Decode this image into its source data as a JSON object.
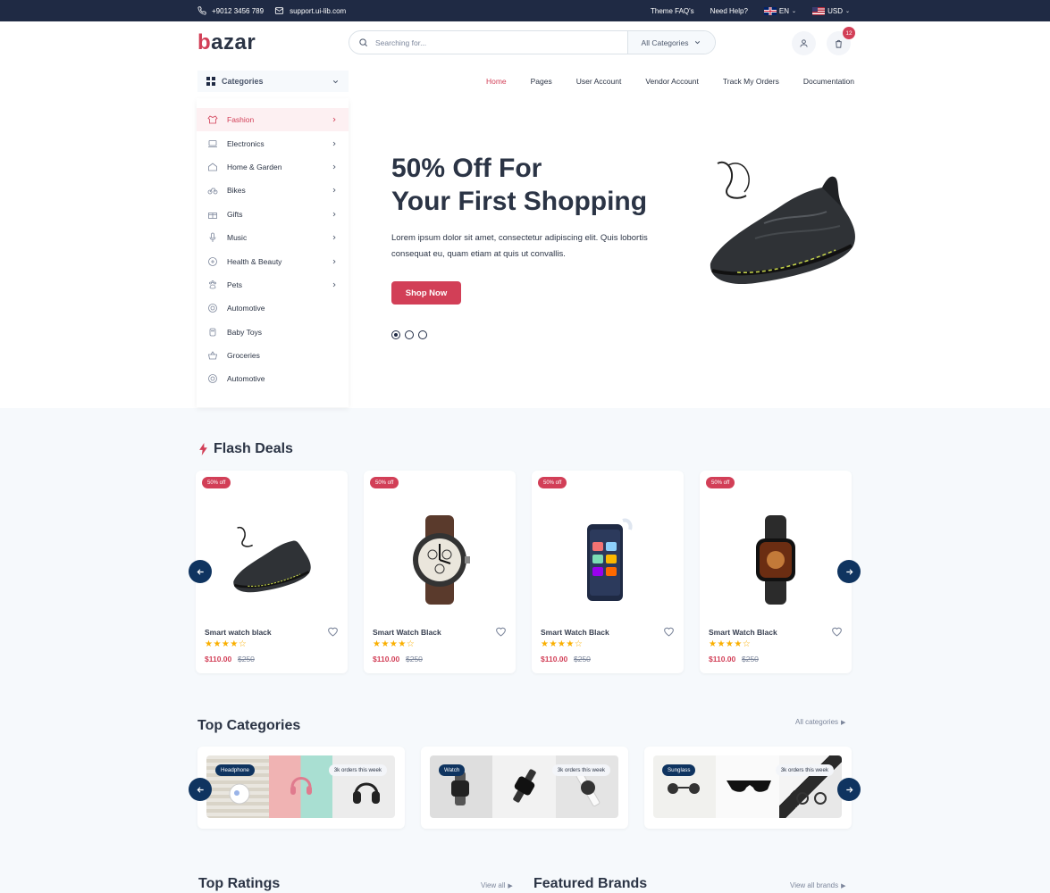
{
  "topbar": {
    "phone": "+9012 3456 789",
    "email": "support.ui-lib.com",
    "faq": "Theme FAQ's",
    "help": "Need Help?",
    "language": "EN",
    "currency": "USD"
  },
  "header": {
    "logo_b": "b",
    "logo_rest": "azar",
    "search_placeholder": "Searching for...",
    "search_category": "All Categories",
    "cart_count": "12"
  },
  "categories_button": "Categories",
  "nav": [
    "Home",
    "Pages",
    "User Account",
    "Vendor Account",
    "Track My Orders",
    "Documentation"
  ],
  "category_menu": [
    {
      "label": "Fashion",
      "icon": "fashion-icon",
      "arrow": true
    },
    {
      "label": "Electronics",
      "icon": "laptop-icon",
      "arrow": true
    },
    {
      "label": "Home & Garden",
      "icon": "home-icon",
      "arrow": true
    },
    {
      "label": "Bikes",
      "icon": "bike-icon",
      "arrow": true
    },
    {
      "label": "Gifts",
      "icon": "gift-icon",
      "arrow": true
    },
    {
      "label": "Music",
      "icon": "microphone-icon",
      "arrow": true
    },
    {
      "label": "Health & Beauty",
      "icon": "health-icon",
      "arrow": true
    },
    {
      "label": "Pets",
      "icon": "paw-icon",
      "arrow": true
    },
    {
      "label": "Automotive",
      "icon": "wheel-icon",
      "arrow": false
    },
    {
      "label": "Baby Toys",
      "icon": "toy-icon",
      "arrow": false
    },
    {
      "label": "Groceries",
      "icon": "basket-icon",
      "arrow": false
    },
    {
      "label": "Automotive",
      "icon": "wheel-icon",
      "arrow": false
    }
  ],
  "hero": {
    "title_line1": "50% Off For",
    "title_line2": "Your First Shopping",
    "text": "Lorem ipsum dolor sit amet, consectetur adipiscing elit. Quis lobortis consequat eu, quam etiam at quis ut convallis.",
    "button": "Shop Now"
  },
  "flash_deals": {
    "title": "Flash Deals",
    "products": [
      {
        "name": "Smart watch black",
        "badge": "50% off",
        "price": "$110.00",
        "old_price": "$250",
        "rating": 4,
        "image": "sneaker"
      },
      {
        "name": "Smart Watch Black",
        "badge": "50% off",
        "price": "$110.00",
        "old_price": "$250",
        "rating": 4,
        "image": "chronograph-watch"
      },
      {
        "name": "Smart Watch Black",
        "badge": "50% off",
        "price": "$110.00",
        "old_price": "$250",
        "rating": 4,
        "image": "smartphone"
      },
      {
        "name": "Smart Watch Black",
        "badge": "50% off",
        "price": "$110.00",
        "old_price": "$250",
        "rating": 4,
        "image": "smartwatch"
      }
    ]
  },
  "top_categories": {
    "title": "Top Categories",
    "link": "All categories",
    "items": [
      {
        "tag": "Headphone",
        "orders": "3k orders this week"
      },
      {
        "tag": "Watch",
        "orders": "3k orders this week"
      },
      {
        "tag": "Sunglass",
        "orders": "3k orders this week"
      }
    ]
  },
  "bottom": {
    "top_ratings": "Top Ratings",
    "view_all": "View all",
    "featured_brands": "Featured Brands",
    "view_all_brands": "View all brands"
  },
  "colors": {
    "primary": "#d23f57",
    "dark": "#1f2a44",
    "navy": "#0f3460",
    "star": "#faaf00"
  }
}
